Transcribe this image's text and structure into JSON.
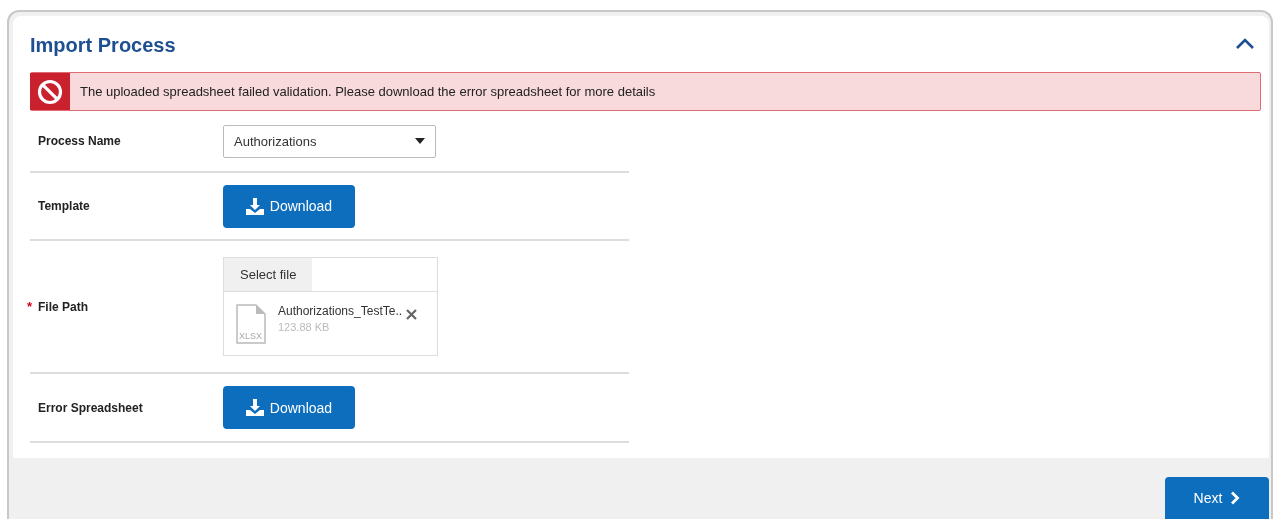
{
  "panel": {
    "title": "Import Process",
    "expanded": true
  },
  "alert": {
    "message": "The uploaded spreadsheet failed validation. Please download the error spreadsheet for more details"
  },
  "fields": [
    {
      "label": "Process Name",
      "kind": "select",
      "value": "Authorizations"
    },
    {
      "label": "Template",
      "kind": "button",
      "button_label": "Download"
    },
    {
      "label": "File Path",
      "required_mark": "*",
      "kind": "file",
      "select_label": "Select file",
      "file": {
        "type": "XLSX",
        "name": "Authorizations_TestTe..",
        "size": "123.88 KB"
      }
    },
    {
      "label": "Error Spreadsheet",
      "kind": "button",
      "button_label": "Download"
    }
  ],
  "footer": {
    "next_label": "Next"
  }
}
